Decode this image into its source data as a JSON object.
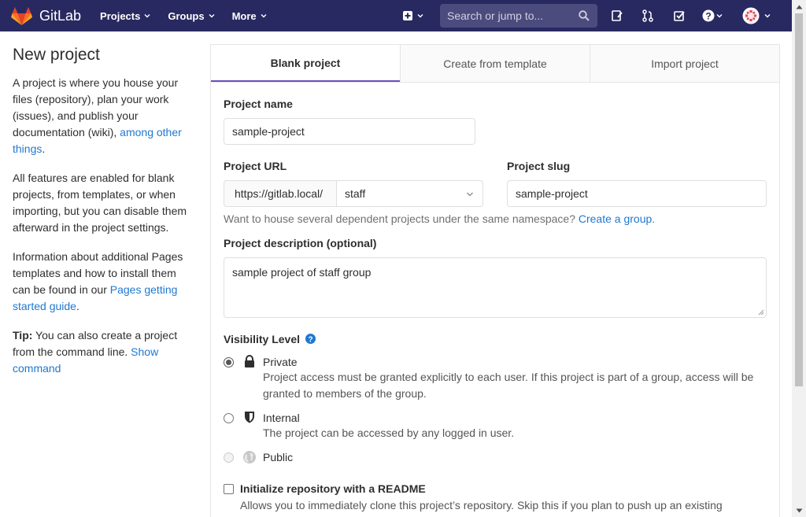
{
  "navbar": {
    "brand": "GitLab",
    "menus": [
      "Projects",
      "Groups",
      "More"
    ],
    "search_placeholder": "Search or jump to...",
    "bg_color": "#292961"
  },
  "sidebar": {
    "title": "New project",
    "p1_text": "A project is where you house your files (repository), plan your work (issues), and publish your documentation (wiki), ",
    "p1_link": "among other things",
    "p1_end": ".",
    "p2": "All features are enabled for blank projects, from templates, or when importing, but you can disable them afterward in the project settings.",
    "p3_text": "Information about additional Pages templates and how to install them can be found in our ",
    "p3_link": "Pages getting started guide",
    "p3_end": ".",
    "tip_label": "Tip:",
    "tip_text": " You can also create a project from the command line. ",
    "tip_link": "Show command"
  },
  "tabs": [
    "Blank project",
    "Create from template",
    "Import project"
  ],
  "form": {
    "project_name_label": "Project name",
    "project_name_value": "sample-project",
    "project_url_label": "Project URL",
    "url_prefix": "https://gitlab.local/",
    "namespace_value": "staff",
    "project_slug_label": "Project slug",
    "project_slug_value": "sample-project",
    "group_help_text": "Want to house several dependent projects under the same namespace? ",
    "group_help_link": "Create a group.",
    "description_label": "Project description (optional)",
    "description_value": "sample project of staff group",
    "visibility_label": "Visibility Level",
    "visibility": {
      "private_title": "Private",
      "private_desc": "Project access must be granted explicitly to each user. If this project is part of a group, access will be granted to members of the group.",
      "internal_title": "Internal",
      "internal_desc": "The project can be accessed by any logged in user.",
      "public_title": "Public",
      "selected": "Private"
    },
    "readme_label": "Initialize repository with a README",
    "readme_desc": "Allows you to immediately clone this project’s repository. Skip this if you plan to push up an existing"
  }
}
